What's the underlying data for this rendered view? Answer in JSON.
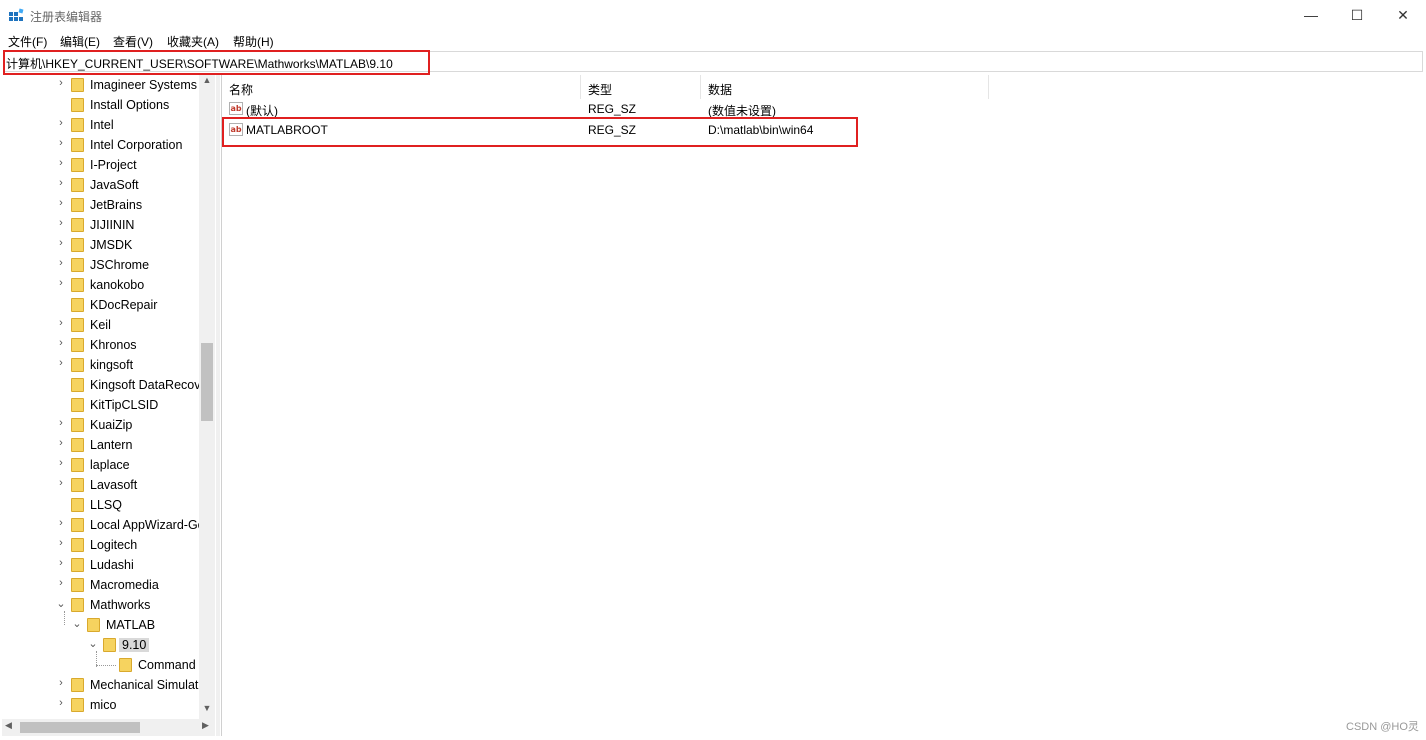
{
  "window": {
    "title": "注册表编辑器",
    "min_glyph": "—",
    "max_glyph": "☐",
    "close_glyph": "✕"
  },
  "menu": [
    "文件(F)",
    "编辑(E)",
    "查看(V)",
    "收藏夹(A)",
    "帮助(H)"
  ],
  "address": {
    "path": "计算机\\HKEY_CURRENT_USER\\SOFTWARE\\Mathworks\\MATLAB\\9.10"
  },
  "tree": {
    "items": [
      {
        "label": "Imagineer Systems",
        "expander": "collapsed",
        "level": 0
      },
      {
        "label": "Install Options",
        "expander": "none",
        "level": 0
      },
      {
        "label": "Intel",
        "expander": "collapsed",
        "level": 0
      },
      {
        "label": "Intel Corporation",
        "expander": "collapsed",
        "level": 0
      },
      {
        "label": "I-Project",
        "expander": "collapsed",
        "level": 0
      },
      {
        "label": "JavaSoft",
        "expander": "collapsed",
        "level": 0
      },
      {
        "label": "JetBrains",
        "expander": "collapsed",
        "level": 0
      },
      {
        "label": "JIJIININ",
        "expander": "collapsed",
        "level": 0
      },
      {
        "label": "JMSDK",
        "expander": "collapsed",
        "level": 0
      },
      {
        "label": "JSChrome",
        "expander": "collapsed",
        "level": 0
      },
      {
        "label": "kanokobo",
        "expander": "collapsed",
        "level": 0
      },
      {
        "label": "KDocRepair",
        "expander": "none",
        "level": 0
      },
      {
        "label": "Keil",
        "expander": "collapsed",
        "level": 0
      },
      {
        "label": "Khronos",
        "expander": "collapsed",
        "level": 0
      },
      {
        "label": "kingsoft",
        "expander": "collapsed",
        "level": 0
      },
      {
        "label": "Kingsoft DataRecovery",
        "expander": "none",
        "level": 0
      },
      {
        "label": "KitTipCLSID",
        "expander": "none",
        "level": 0
      },
      {
        "label": "KuaiZip",
        "expander": "collapsed",
        "level": 0
      },
      {
        "label": "Lantern",
        "expander": "collapsed",
        "level": 0
      },
      {
        "label": "laplace",
        "expander": "collapsed",
        "level": 0
      },
      {
        "label": "Lavasoft",
        "expander": "collapsed",
        "level": 0
      },
      {
        "label": "LLSQ",
        "expander": "none",
        "level": 0
      },
      {
        "label": "Local AppWizard-Generated Applications",
        "expander": "collapsed",
        "level": 0
      },
      {
        "label": "Logitech",
        "expander": "collapsed",
        "level": 0
      },
      {
        "label": "Ludashi",
        "expander": "collapsed",
        "level": 0
      },
      {
        "label": "Macromedia",
        "expander": "collapsed",
        "level": 0
      },
      {
        "label": "Mathworks",
        "expander": "expanded",
        "level": 0
      },
      {
        "label": "MATLAB",
        "expander": "expanded",
        "level": 1
      },
      {
        "label": "9.10",
        "expander": "expanded",
        "level": 2,
        "selected": true
      },
      {
        "label": "Command",
        "expander": "none",
        "level": 3
      },
      {
        "label": "Mechanical Simulation",
        "expander": "collapsed",
        "level": 0
      },
      {
        "label": "mico",
        "expander": "collapsed",
        "level": 0
      }
    ]
  },
  "list": {
    "columns": [
      "名称",
      "类型",
      "数据"
    ],
    "rows": [
      {
        "name": "(默认)",
        "type": "REG_SZ",
        "data": "(数值未设置)",
        "icon": "string-value-icon"
      },
      {
        "name": "MATLABROOT",
        "type": "REG_SZ",
        "data": "D:\\matlab\\bin\\win64",
        "icon": "string-value-icon"
      }
    ],
    "icon_text": "ab"
  },
  "watermark": "CSDN @HO灵",
  "colors": {
    "highlight_box": "#e02020",
    "folder": "#f6d35f"
  }
}
